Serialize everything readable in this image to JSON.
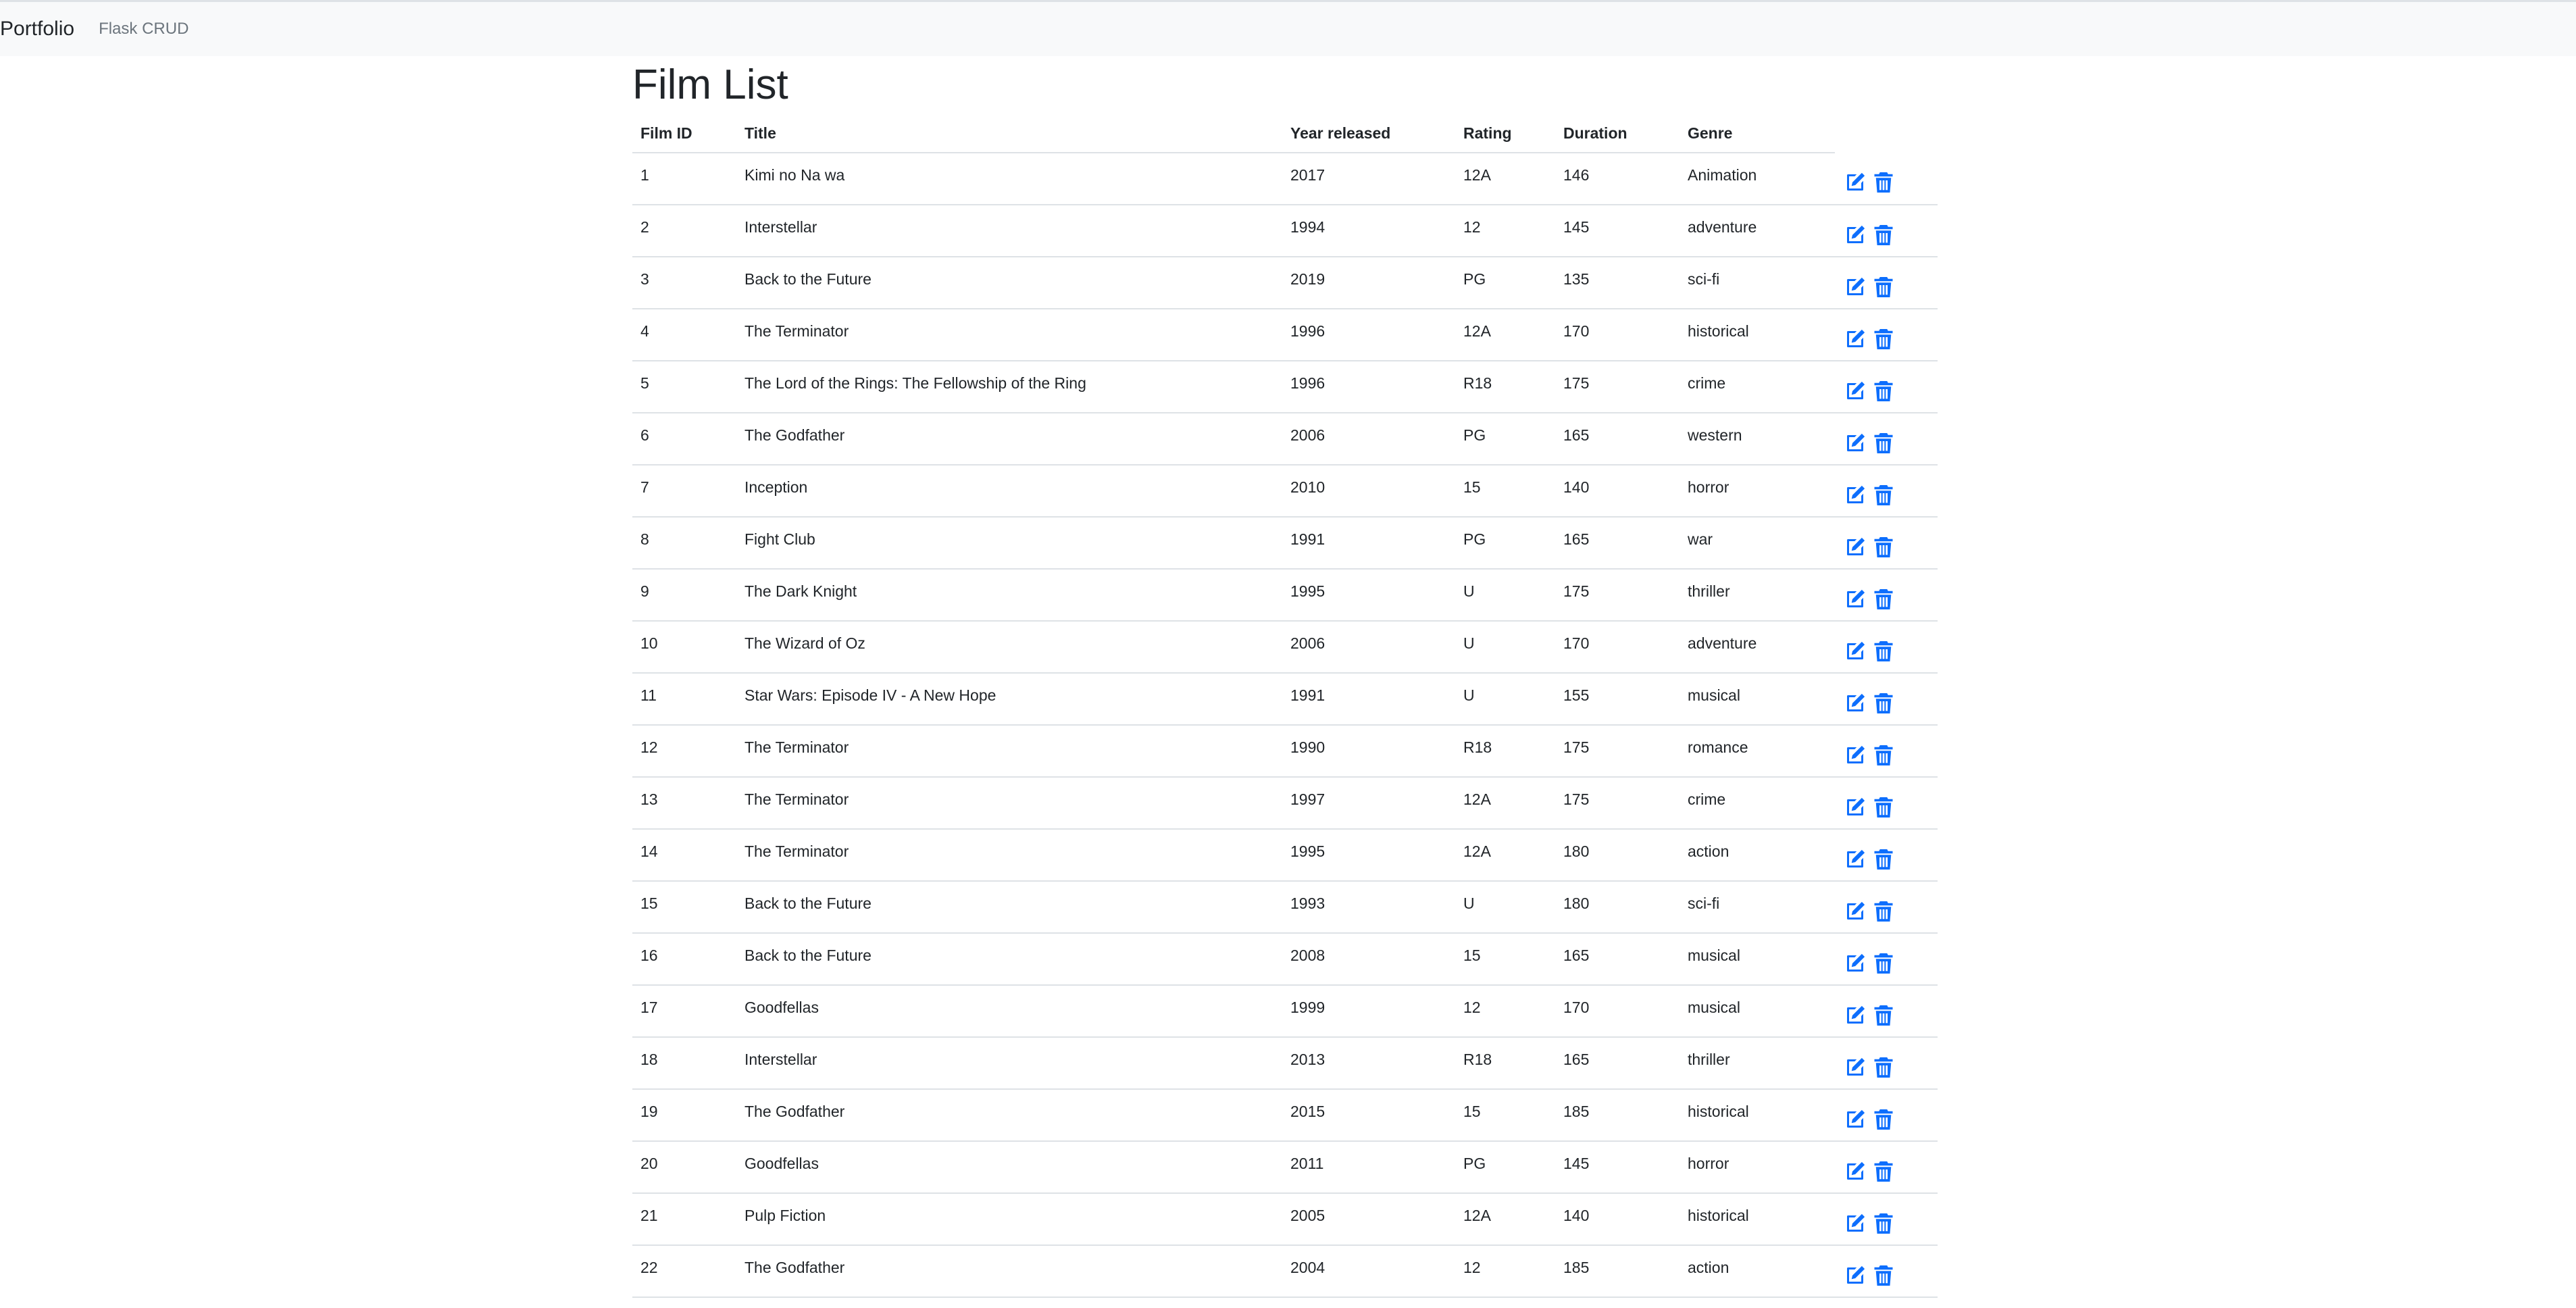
{
  "navbar": {
    "brand": "Portfolio",
    "link": "Flask CRUD"
  },
  "page": {
    "title": "Film List"
  },
  "colors": {
    "accent": "#0d6efd",
    "navbar_bg": "#f8f9fa",
    "border": "#dee2e6"
  },
  "icons": {
    "edit": "edit-icon",
    "delete": "trash-icon"
  },
  "table": {
    "headers": [
      "Film ID",
      "Title",
      "Year released",
      "Rating",
      "Duration",
      "Genre"
    ],
    "rows": [
      [
        "1",
        "Kimi no Na wa",
        "2017",
        "12A",
        "146",
        "Animation"
      ],
      [
        "2",
        "Interstellar",
        "1994",
        "12",
        "145",
        "adventure"
      ],
      [
        "3",
        "Back to the Future",
        "2019",
        "PG",
        "135",
        "sci-fi"
      ],
      [
        "4",
        "The Terminator",
        "1996",
        "12A",
        "170",
        "historical"
      ],
      [
        "5",
        "The Lord of the Rings: The Fellowship of the Ring",
        "1996",
        "R18",
        "175",
        "crime"
      ],
      [
        "6",
        "The Godfather",
        "2006",
        "PG",
        "165",
        "western"
      ],
      [
        "7",
        "Inception",
        "2010",
        "15",
        "140",
        "horror"
      ],
      [
        "8",
        "Fight Club",
        "1991",
        "PG",
        "165",
        "war"
      ],
      [
        "9",
        "The Dark Knight",
        "1995",
        "U",
        "175",
        "thriller"
      ],
      [
        "10",
        "The Wizard of Oz",
        "2006",
        "U",
        "170",
        "adventure"
      ],
      [
        "11",
        "Star Wars: Episode IV - A New Hope",
        "1991",
        "U",
        "155",
        "musical"
      ],
      [
        "12",
        "The Terminator",
        "1990",
        "R18",
        "175",
        "romance"
      ],
      [
        "13",
        "The Terminator",
        "1997",
        "12A",
        "175",
        "crime"
      ],
      [
        "14",
        "The Terminator",
        "1995",
        "12A",
        "180",
        "action"
      ],
      [
        "15",
        "Back to the Future",
        "1993",
        "U",
        "180",
        "sci-fi"
      ],
      [
        "16",
        "Back to the Future",
        "2008",
        "15",
        "165",
        "musical"
      ],
      [
        "17",
        "Goodfellas",
        "1999",
        "12",
        "170",
        "musical"
      ],
      [
        "18",
        "Interstellar",
        "2013",
        "R18",
        "165",
        "thriller"
      ],
      [
        "19",
        "The Godfather",
        "2015",
        "15",
        "185",
        "historical"
      ],
      [
        "20",
        "Goodfellas",
        "2011",
        "PG",
        "145",
        "horror"
      ],
      [
        "21",
        "Pulp Fiction",
        "2005",
        "12A",
        "140",
        "historical"
      ],
      [
        "22",
        "The Godfather",
        "2004",
        "12",
        "185",
        "action"
      ]
    ]
  }
}
